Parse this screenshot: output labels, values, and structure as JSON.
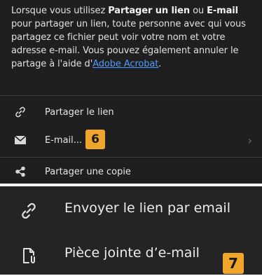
{
  "share_sheet": {
    "info": {
      "part1": "Lorsque vous utilisez ",
      "bold1": "Partager un lien",
      "part2": " ou ",
      "bold2": "E-mail",
      "part3": " pour partager un lien, toute personne avec qui vous partagez ce fichier peut voir votre nom et votre adresse e-mail. Vous pouvez également annuler le partage à l'aide d'",
      "link": "Adobe Acrobat",
      "part4": "."
    },
    "options": [
      {
        "label": "Partager le lien",
        "icon": "link-icon"
      },
      {
        "label": "E-mail...",
        "icon": "envelope-icon",
        "badge": "6"
      },
      {
        "label": "Partager une copie",
        "icon": "share-icon"
      }
    ]
  },
  "email_options": [
    {
      "label": "Envoyer le lien par email",
      "icon": "link-icon"
    },
    {
      "label": "Pièce jointe d’e-mail",
      "icon": "attachment-file-icon",
      "badge": "7"
    }
  ],
  "colors": {
    "panel_bg": "#1f1f1f",
    "link": "#4f9bff",
    "badge": "#f0a52b"
  }
}
